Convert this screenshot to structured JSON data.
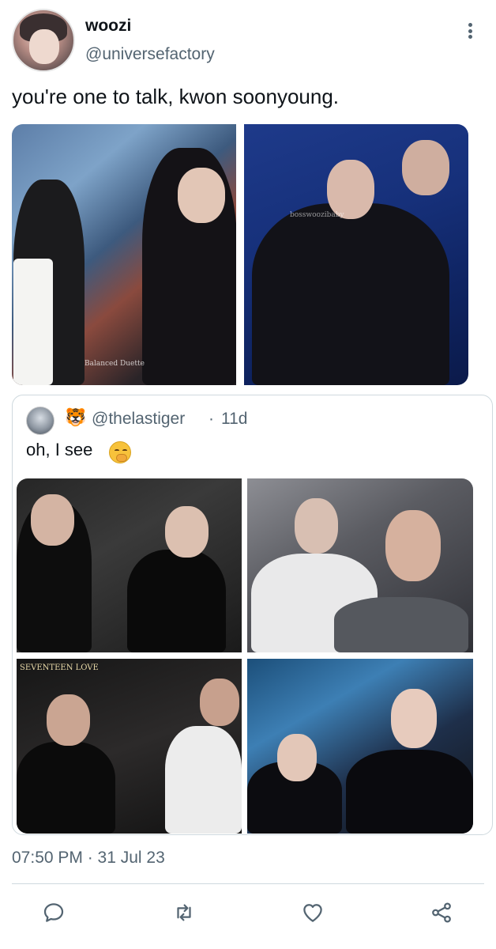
{
  "tweet": {
    "display_name": "woozi",
    "handle": "@universefactory",
    "text": "you're one to talk, kwon soonyoung.",
    "watermarks": [
      "Balanced Duette",
      "bosswoozibaby"
    ],
    "timestamp": "07:50 PM · 31 Jul 23"
  },
  "quoted_tweet": {
    "handle_emoji": "🐯",
    "handle": "@thelastiger",
    "separator": "·",
    "time": "11d",
    "text": "oh, I see",
    "text_emoji_icon": "shushing-face-icon",
    "watermarks": [
      "SEVENTEEN LOVE"
    ]
  },
  "actions": [
    {
      "name": "reply",
      "icon": "reply-icon"
    },
    {
      "name": "retweet",
      "icon": "retweet-icon"
    },
    {
      "name": "like",
      "icon": "heart-icon"
    },
    {
      "name": "share",
      "icon": "share-icon"
    }
  ],
  "colors": {
    "primary_text": "#0f1419",
    "secondary_text": "#536471",
    "border": "#cfd9de"
  }
}
